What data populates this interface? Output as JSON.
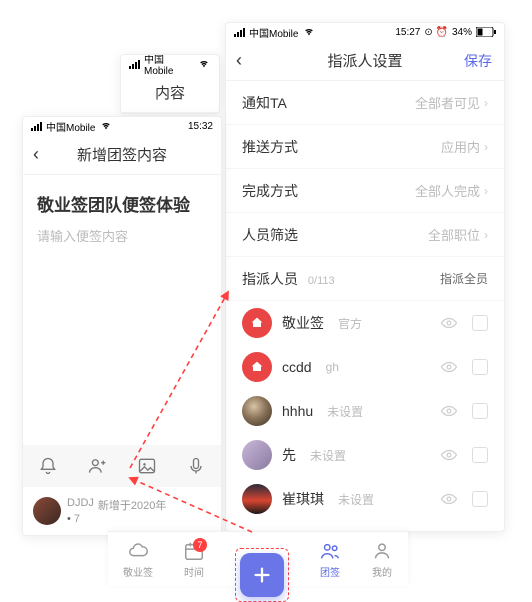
{
  "status": {
    "carrier": "中国Mobile",
    "time_a": "15:32",
    "time_c": "15:27",
    "battery": "34%",
    "alarm": "⏰"
  },
  "phone_a": {
    "title": "内容"
  },
  "phone_b": {
    "nav_title": "新增团签内容",
    "title": "敬业签团队便签体验",
    "placeholder": "请输入便签内容",
    "footer_user": "DJDJ",
    "footer_time": "新增于2020年",
    "count": "7"
  },
  "phone_c": {
    "nav_title": "指派人设置",
    "save": "保存",
    "rows": [
      {
        "label": "通知TA",
        "value": "全部者可见"
      },
      {
        "label": "推送方式",
        "value": "应用内"
      },
      {
        "label": "完成方式",
        "value": "全部人完成"
      },
      {
        "label": "人员筛选",
        "value": "全部职位"
      }
    ],
    "assign_label": "指派人员",
    "assign_count": "0/113",
    "assign_all": "指派全员",
    "members": [
      {
        "name": "敬业签",
        "sub": "官方",
        "avatar": "red"
      },
      {
        "name": "ccdd",
        "sub": "gh",
        "avatar": "red"
      },
      {
        "name": "hhhu",
        "sub": "未设置",
        "avatar": "photo1"
      },
      {
        "name": "先",
        "sub": "未设置",
        "avatar": "photo2"
      },
      {
        "name": "崔琪琪",
        "sub": "未设置",
        "avatar": "photo3"
      }
    ]
  },
  "tabs": [
    {
      "label": "敬业签"
    },
    {
      "label": "时间",
      "badge": "7"
    },
    {
      "label": ""
    },
    {
      "label": "团签"
    },
    {
      "label": "我的"
    }
  ]
}
